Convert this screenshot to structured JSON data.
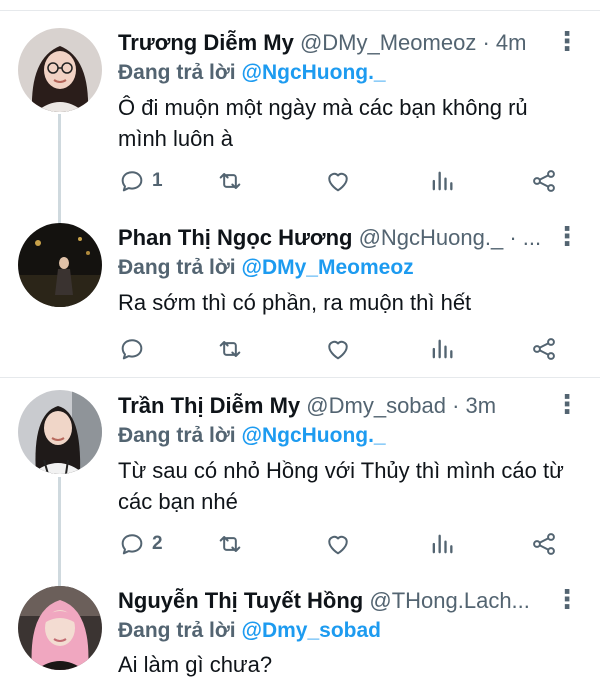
{
  "replies": [
    {
      "name": "Trương Diễm My",
      "handle": "@DMy_Meomeoz · 4m",
      "reply_prefix": "Đang trả lời",
      "reply_to": "@NgcHuong._",
      "text": "Ô đi muộn một ngày mà các bạn không rủ mình luôn à",
      "reply_count": "1",
      "avatar_icon": "avatar-woman-glasses"
    },
    {
      "name": "Phan Thị Ngọc Hương",
      "handle": "@NgcHuong._ · ...",
      "reply_prefix": "Đang trả lời",
      "reply_to": "@DMy_Meomeoz",
      "text": "Ra sớm thì có phần, ra muộn thì hết",
      "reply_count": "",
      "avatar_icon": "avatar-woman-night"
    },
    {
      "name": "Trần Thị Diễm My",
      "handle": "@Dmy_sobad · 3m",
      "reply_prefix": "Đang trả lời",
      "reply_to": "@NgcHuong._",
      "text": "Từ sau có nhỏ Hồng với Thủy thì mình cáo từ các bạn nhé",
      "reply_count": "2",
      "avatar_icon": "avatar-woman-dark-hair"
    },
    {
      "name": "Nguyễn Thị Tuyết Hồng",
      "handle": "@THong.Lach...",
      "reply_prefix": "Đang trả lời",
      "reply_to": "@Dmy_sobad",
      "text": "Ai làm gì chưa?",
      "reply_count": "",
      "avatar_icon": "avatar-woman-pink-hair"
    }
  ],
  "colors": {
    "link_blue": "#1d9bf0",
    "secondary_text": "#536471",
    "thread_line": "#cfd9de"
  },
  "icons": {
    "more": "more-vertical-icon",
    "reply": "reply-icon",
    "retweet": "retweet-icon",
    "like": "heart-icon",
    "views": "views-icon",
    "share": "share-icon"
  }
}
